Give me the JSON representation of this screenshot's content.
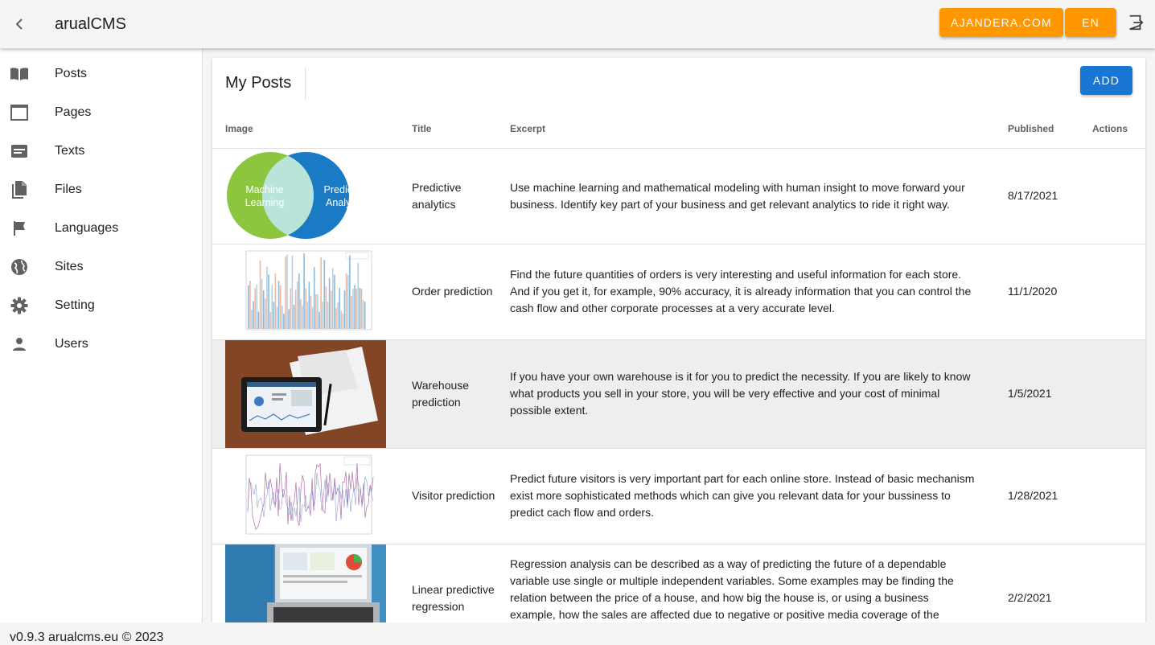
{
  "header": {
    "title": "arualCMS",
    "site_button": "AJANDERA.COM",
    "lang_button": "EN",
    "accent_color": "#ff9800"
  },
  "sidebar": {
    "items": [
      {
        "label": "Posts",
        "icon": "book-open-icon"
      },
      {
        "label": "Pages",
        "icon": "window-icon"
      },
      {
        "label": "Texts",
        "icon": "text-box-icon"
      },
      {
        "label": "Files",
        "icon": "file-icon"
      },
      {
        "label": "Languages",
        "icon": "flag-icon"
      },
      {
        "label": "Sites",
        "icon": "globe-icon"
      },
      {
        "label": "Setting",
        "icon": "gear-icon"
      },
      {
        "label": "Users",
        "icon": "person-icon"
      }
    ]
  },
  "main": {
    "title": "My Posts",
    "add_button": "ADD",
    "add_color": "#1976d2",
    "columns": {
      "image": "Image",
      "title": "Title",
      "excerpt": "Excerpt",
      "published": "Published",
      "actions": "Actions"
    },
    "rows": [
      {
        "title": "Predictive analytics",
        "excerpt": "Use machine learning and mathematical modeling with human insight to move forward your business. Identify key part of your business and get relevant analytics to ride it right way.",
        "published": "8/17/2021",
        "image": {
          "left": "Machine Learning",
          "right": "Predictive Analytics"
        }
      },
      {
        "title": "Order prediction",
        "excerpt": "Find the future quantities of orders is very interesting and useful information for each store. And if you get it, for example, 90% accuracy, it is already information that you can control the cash flow and other corporate processes at a very accurate level.",
        "published": "11/1/2020"
      },
      {
        "title": "Warehouse prediction",
        "excerpt": "If you have your own warehouse is it for you to predict the necessity. If you are likely to know what products you sell in your store, you will be very effective and your cost of minimal possible extent.",
        "published": "1/5/2021"
      },
      {
        "title": "Visitor prediction",
        "excerpt": "Predict future visitors is very important part for each online store. Instead of basic mechanism exist more sophisticated methods which can give you relevant data for your bussiness to predict cach flow and orders.",
        "published": "1/28/2021"
      },
      {
        "title": "Linear predictive regression",
        "excerpt": "Regression analysis can be described as a way of predicting the future of a dependable variable use single or multiple independent variables. Some examples may be finding the relation between the price of a house, and how big the house is, or using a business example, how the sales are affected due to negative or positive media coverage of the company.",
        "published": "2/2/2021"
      }
    ]
  },
  "footer": {
    "text": "v0.9.3 arualcms.eu © 2023"
  }
}
